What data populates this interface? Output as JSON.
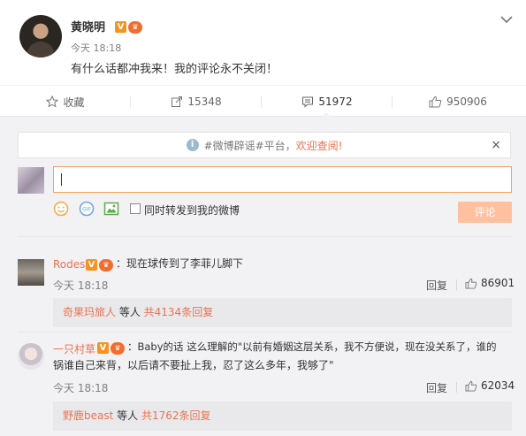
{
  "post": {
    "author": "黄晓明",
    "time": "今天 18:18",
    "text": "有什么话都冲我来！我的评论永不关闭！"
  },
  "actions": [
    {
      "label": "收藏",
      "icon": "star-icon"
    },
    {
      "label": "15348",
      "icon": "repost-icon"
    },
    {
      "label": "51972",
      "icon": "comment-icon"
    },
    {
      "label": "950906",
      "icon": "thumbs-up-icon"
    }
  ],
  "notice": {
    "prefix": "#微博辟谣#平台，",
    "link": "欢迎查阅!",
    "close": "×"
  },
  "composer": {
    "repost_label": "同时转发到我的微博",
    "submit_label": "评论"
  },
  "comments": [
    {
      "name": "Rodes",
      "text": "：现在球传到了李菲儿脚下",
      "time": "今天 18:18",
      "reply_label": "回复",
      "likes": "86901",
      "sub_user": "奇果玛旅人",
      "sub_mid": " 等人 ",
      "sub_count": "共4134条回复"
    },
    {
      "name": "一只村草",
      "text_line1": "：Baby的话 这么理解的\"以前有婚姻这层关系，我不方便说，现在没关系了，谁的",
      "text_line2": "锅谁自己来背，以后请不要扯上我，忍了这么多年，我够了\"",
      "time": "今天 18:18",
      "reply_label": "回复",
      "likes": "62034",
      "sub_user": "野鹿beast",
      "sub_mid": " 等人 ",
      "sub_count": "共1762条回复"
    }
  ],
  "colors": {
    "accent": "#eb7350",
    "input_border": "#f8a05a",
    "submit_bg": "#ffc09f",
    "comment_bg": "#f2f2f5"
  }
}
